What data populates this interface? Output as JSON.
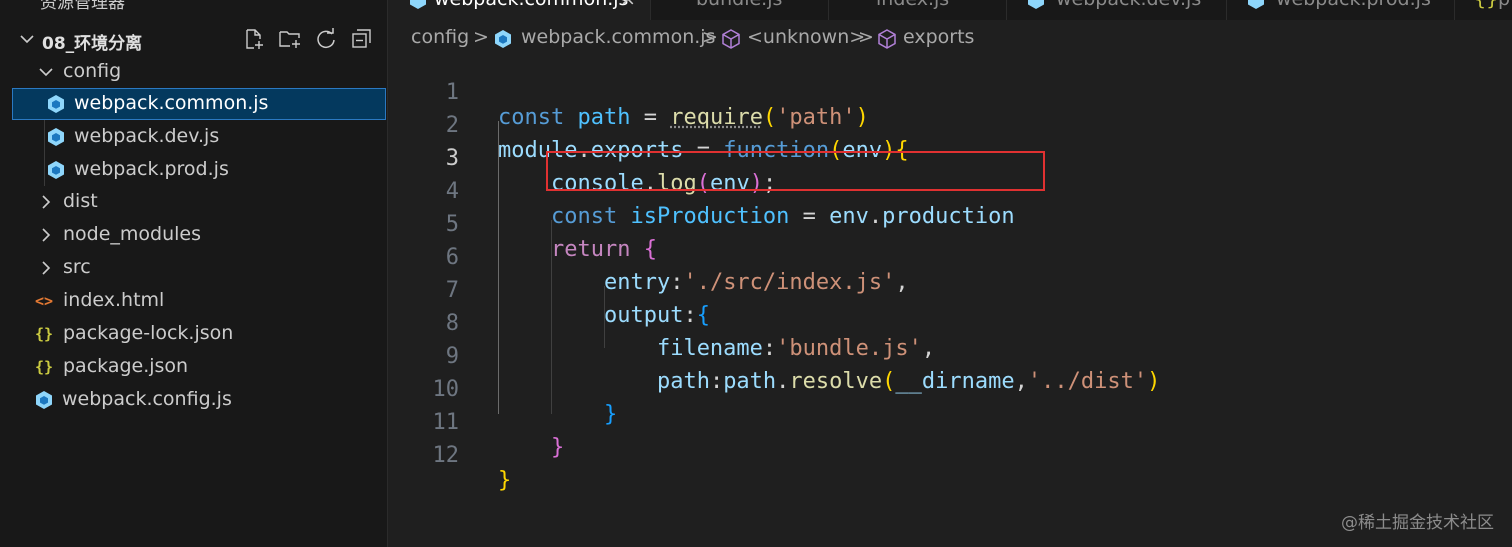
{
  "explorer": {
    "title": "资源管理器",
    "folder_name": "08_环境分离",
    "actions": [
      "new-file-icon",
      "new-folder-icon",
      "refresh-icon",
      "collapse-all-icon"
    ],
    "tree": [
      {
        "label": "config",
        "type": "folder-open"
      },
      {
        "label": "webpack.common.js",
        "type": "js",
        "selected": true
      },
      {
        "label": "webpack.dev.js",
        "type": "js"
      },
      {
        "label": "webpack.prod.js",
        "type": "js"
      },
      {
        "label": "dist",
        "type": "folder"
      },
      {
        "label": "node_modules",
        "type": "folder"
      },
      {
        "label": "src",
        "type": "folder"
      },
      {
        "label": "index.html",
        "type": "html"
      },
      {
        "label": "package-lock.json",
        "type": "json"
      },
      {
        "label": "package.json",
        "type": "json"
      },
      {
        "label": "webpack.config.js",
        "type": "js"
      }
    ]
  },
  "tabs": [
    {
      "label": "webpack.common.js",
      "active": true
    },
    {
      "label": "bundle.js"
    },
    {
      "label": "index.js"
    },
    {
      "label": "webpack.dev.js"
    },
    {
      "label": "webpack.prod.js"
    },
    {
      "label": "p"
    }
  ],
  "breadcrumb": {
    "items": [
      "config",
      "webpack.common.js",
      "<unknown>",
      "exports"
    ],
    "separator": ">"
  },
  "editor": {
    "current_line": 3,
    "line_numbers": [
      "1",
      "2",
      "3",
      "4",
      "5",
      "6",
      "7",
      "8",
      "9",
      "10",
      "11",
      "12"
    ],
    "code": {
      "l1": {
        "k": "const",
        "v": "path",
        "eq": " = ",
        "fn": "require",
        "o": "(",
        "s": "'path'",
        "c": ")"
      },
      "l2": {
        "v1": "module",
        "dot": ".",
        "v2": "exports",
        "eq": " = ",
        "k": "function",
        "o": "(",
        "p": "env",
        "c": ")",
        "b": "{"
      },
      "l3": {
        "v1": "console",
        "dot": ".",
        "fn": "log",
        "o": "(",
        "p": "env",
        "c": ")",
        "end": ";"
      },
      "l4": {
        "k": "const",
        "c": "isProduction",
        "eq": " = ",
        "v1": "env",
        "dot": ".",
        "v2": "production"
      },
      "l5": {
        "k": "return",
        "b": "{"
      },
      "l6": {
        "v": "entry",
        "colon": ":",
        "s": "'./src/index.js'",
        "comma": ","
      },
      "l7": {
        "v": "output",
        "colon": ":",
        "b": "{"
      },
      "l8": {
        "v": "filename",
        "colon": ":",
        "s": "'bundle.js'",
        "comma": ","
      },
      "l9": {
        "v": "path",
        "colon": ":",
        "v2": "path",
        "dot": ".",
        "fn": "resolve",
        "o": "(",
        "v3": "__dirname",
        "comma": ",",
        "s": "'../dist'",
        "c": ")"
      },
      "l10": {
        "b": "}"
      },
      "l11": {
        "b": "}"
      },
      "l12": {
        "b": "}"
      }
    }
  },
  "watermark": "@稀土掘金技术社区",
  "colors": {
    "keyword": "#569cd6",
    "control_keyword": "#c586c0",
    "variable": "#9cdcfe",
    "constant": "#4fc1ff",
    "function": "#dcdcaa",
    "string": "#ce9178",
    "highlight_border": "#e03131",
    "selection": "#04395e"
  }
}
